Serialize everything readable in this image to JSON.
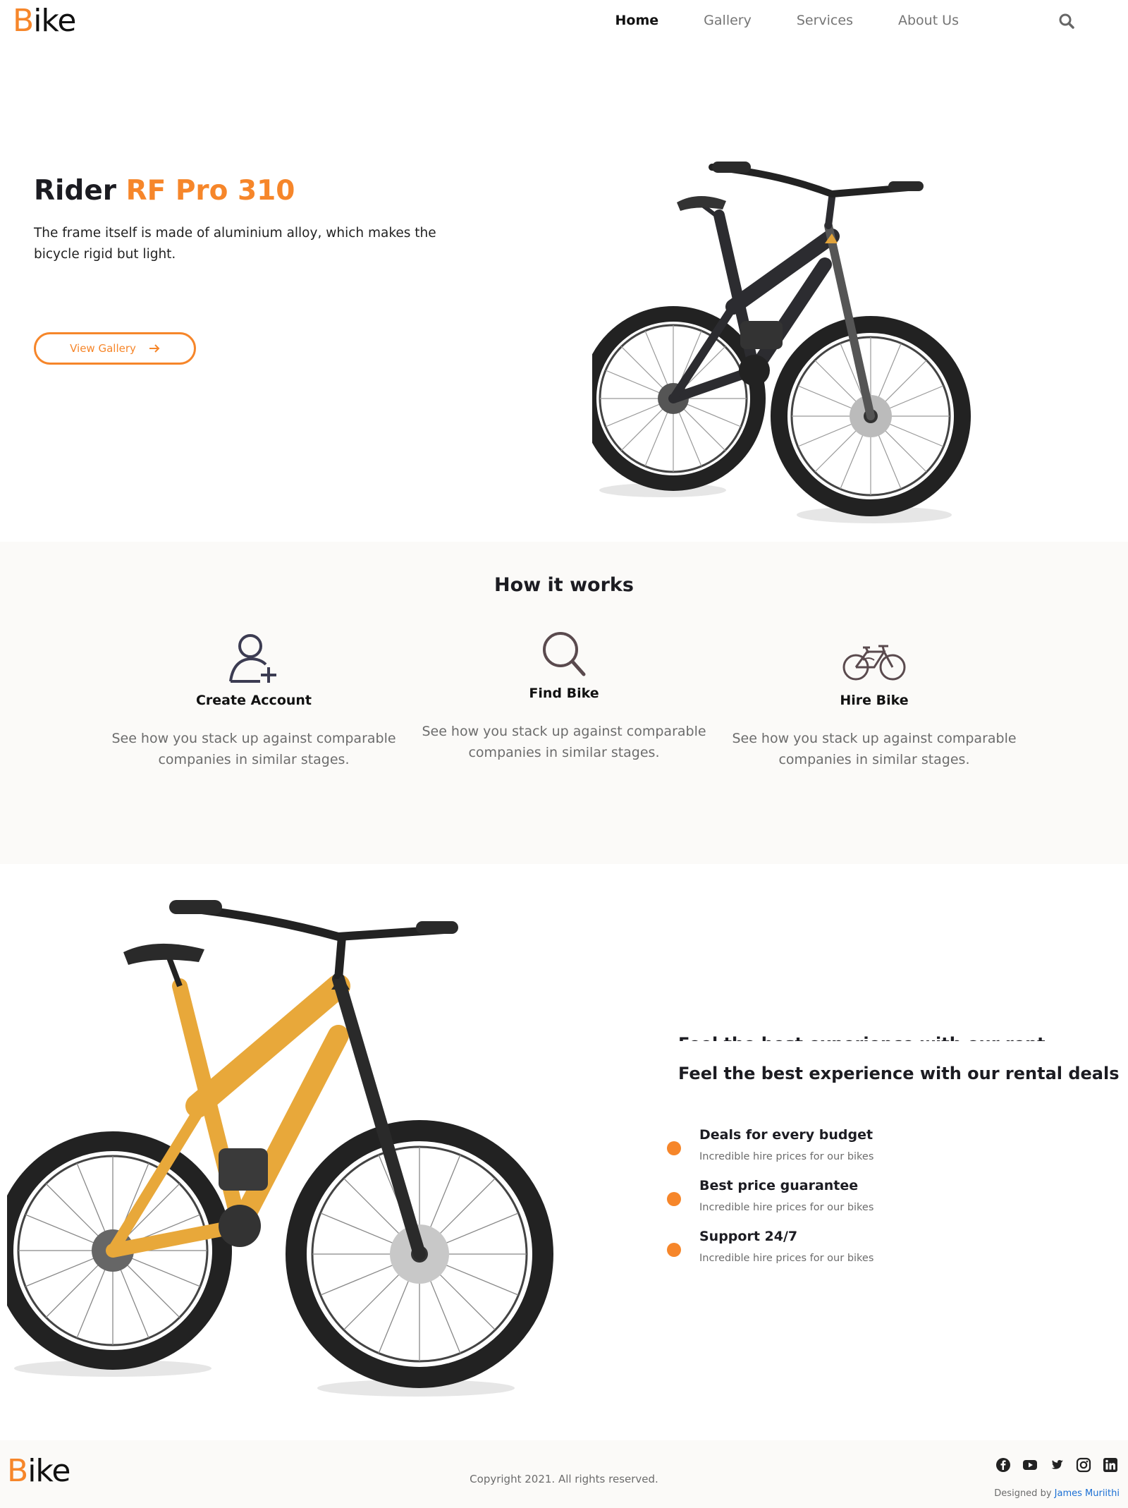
{
  "colors": {
    "accent": "#f6862a",
    "text": "#1c1c22",
    "muted": "#6c6c6c",
    "section_bg": "#fbfaf8"
  },
  "brand": {
    "logo_first": "B",
    "logo_rest": "ike"
  },
  "nav": {
    "items": [
      {
        "label": "Home",
        "active": true
      },
      {
        "label": "Gallery",
        "active": false
      },
      {
        "label": "Services",
        "active": false
      },
      {
        "label": "About Us",
        "active": false
      }
    ],
    "search_icon": "search-icon"
  },
  "hero": {
    "title_plain": "Rider ",
    "title_accent": "RF Pro 310",
    "description": "The frame itself is made of aluminium alloy, which makes the bicycle rigid but light.",
    "button_label": "View Gallery",
    "button_icon": "arrow-right-icon"
  },
  "how_it_works": {
    "title": "How it works",
    "steps": [
      {
        "icon": "user-plus-icon",
        "title": "Create Account",
        "description": "See how you stack up against comparable companies in similar stages."
      },
      {
        "icon": "search-icon",
        "title": "Find Bike",
        "description": "See how you stack up against comparable companies in similar stages."
      },
      {
        "icon": "bicycle-icon",
        "title": "Hire Bike",
        "description": "See how you stack up against comparable companies in similar stages."
      }
    ]
  },
  "features": {
    "title": "Feel the best experience with our rental deals",
    "items": [
      {
        "title": "Deals for every budget",
        "subtitle": "Incredible hire prices for our bikes"
      },
      {
        "title": "Best price guarantee",
        "subtitle": "Incredible hire prices for our bikes"
      },
      {
        "title": "Support 24/7",
        "subtitle": "Incredible hire prices for our bikes"
      }
    ]
  },
  "footer": {
    "copyright": "Copyright 2021. All rights reserved.",
    "designed_by_prefix": "Designed by ",
    "designer": "James Muriithi",
    "social_icons": [
      "facebook-icon",
      "youtube-icon",
      "twitter-icon",
      "instagram-icon",
      "linkedin-icon"
    ]
  }
}
